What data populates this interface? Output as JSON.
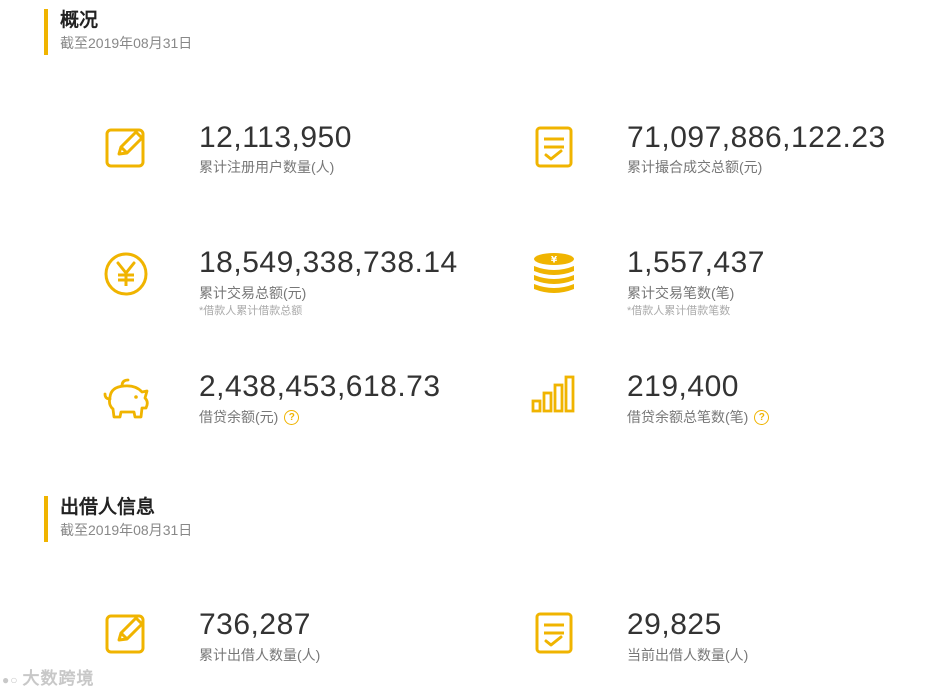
{
  "colors": {
    "accent": "#f0b400",
    "value_text": "#333333",
    "label_text": "#777777"
  },
  "overview": {
    "title": "概况",
    "date": "截至2019年08月31日",
    "stats": [
      {
        "icon": "edit-icon",
        "value": "12,113,950",
        "label": "累计注册用户数量(人)"
      },
      {
        "icon": "checklist-icon",
        "value": "71,097,886,122.23",
        "label": "累计撮合成交总额(元)"
      },
      {
        "icon": "yuan-coin-icon",
        "value": "18,549,338,738.14",
        "label": "累计交易总额(元)",
        "note": "*借款人累计借款总额"
      },
      {
        "icon": "coin-stack-icon",
        "value": "1,557,437",
        "label": "累计交易笔数(笔)",
        "note": "*借款人累计借款笔数"
      },
      {
        "icon": "piggy-bank-icon",
        "value": "2,438,453,618.73",
        "label": "借贷余额(元)",
        "help": "?"
      },
      {
        "icon": "bar-chart-icon",
        "value": "219,400",
        "label": "借贷余额总笔数(笔)",
        "help": "?"
      }
    ]
  },
  "lenders": {
    "title": "出借人信息",
    "date": "截至2019年08月31日",
    "stats": [
      {
        "icon": "edit-icon",
        "value": "736,287",
        "label": "累计出借人数量(人)"
      },
      {
        "icon": "checklist-icon",
        "value": "29,825",
        "label": "当前出借人数量(人)"
      }
    ]
  },
  "watermark": {
    "text": "大数跨境"
  }
}
